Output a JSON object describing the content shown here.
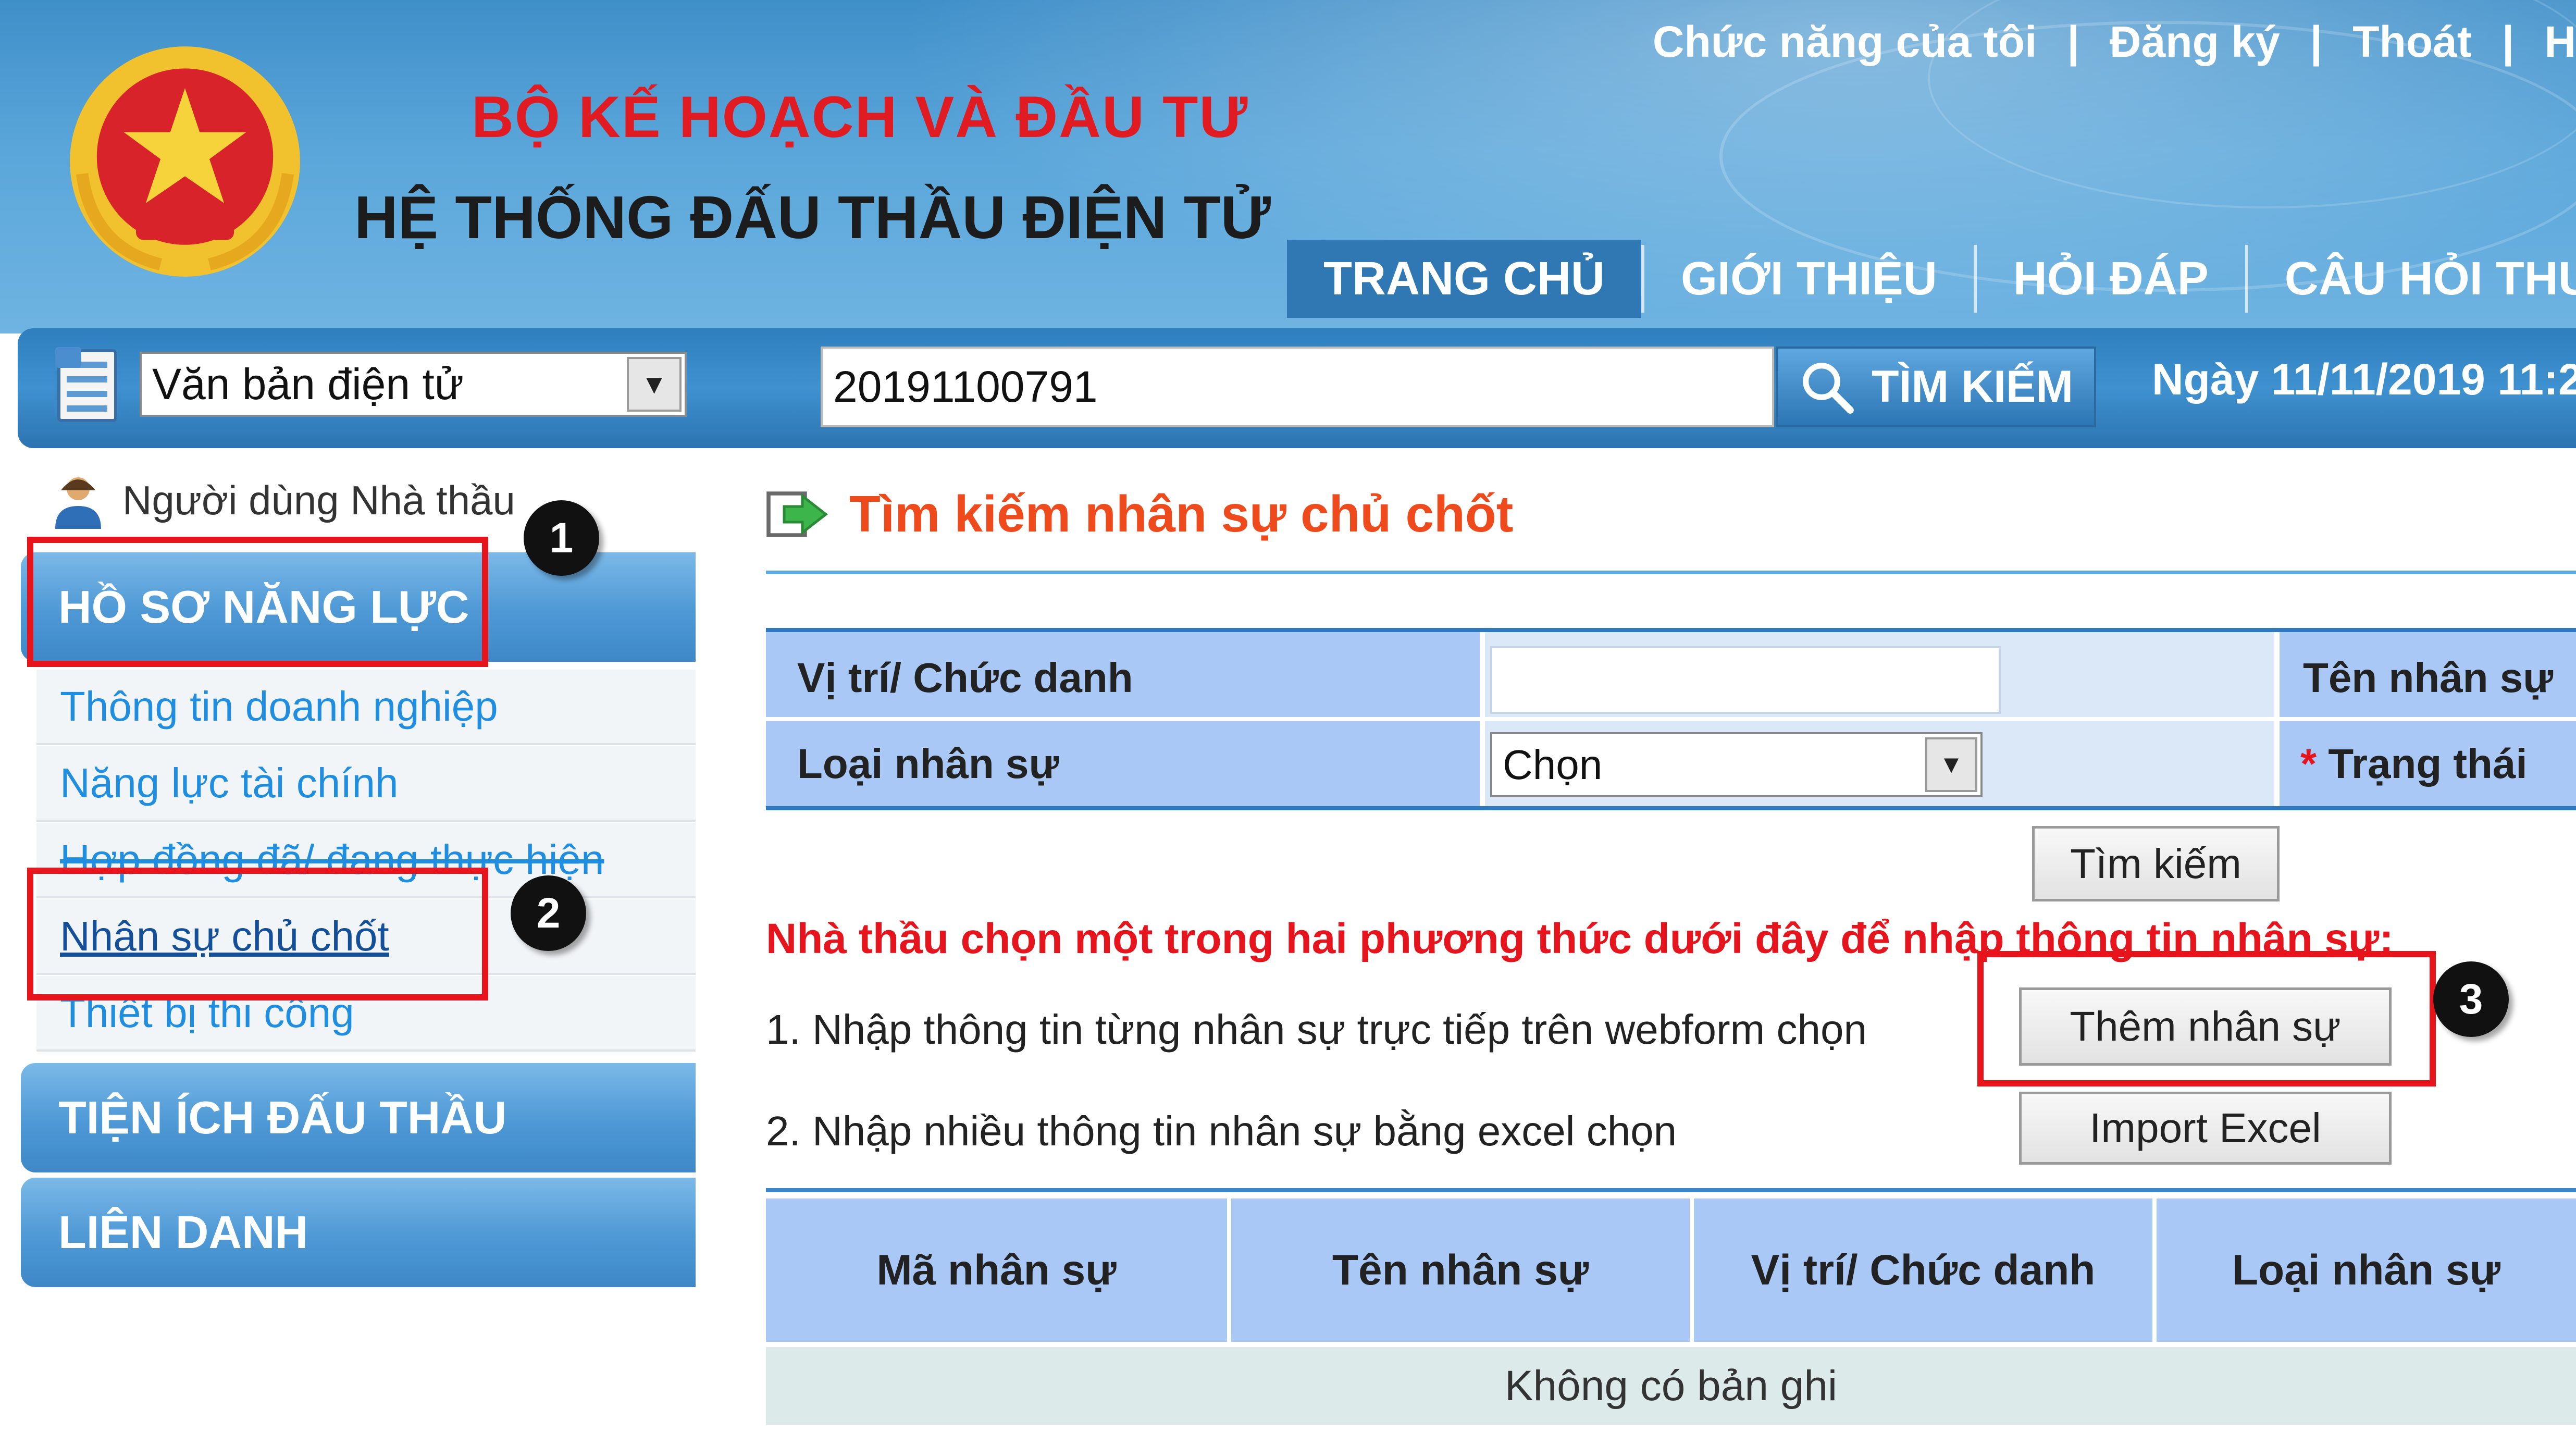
{
  "header": {
    "ministry": "BỘ KẾ HOẠCH VÀ ĐẦU TƯ",
    "system_name": "HỆ THỐNG ĐẤU THẦU ĐIỆN TỬ",
    "top_links": [
      "Chức năng của tôi",
      "Đăng ký",
      "Thoát",
      "H"
    ],
    "nav_tabs": [
      "TRANG CHỦ",
      "GIỚI THIỆU",
      "HỎI ĐÁP",
      "CÂU HỎI THƯỜNG"
    ],
    "active_tab": "TRANG CHỦ",
    "emblem_icon": "national-emblem"
  },
  "search": {
    "doc_type": "Văn bản điện tử",
    "query": "20191100791",
    "button": "TÌM KIẾM",
    "date": "Ngày 11/11/2019 11:2"
  },
  "sidebar": {
    "user": "Người dùng Nhà thầu",
    "sections": [
      {
        "title": "HỒ SƠ NĂNG LỰC",
        "items": [
          "Thông tin doanh nghiệp",
          "Năng lực tài chính",
          "Hợp đồng đã/ đang thực hiện",
          "Nhân sự chủ chốt",
          "Thiết bị thi công"
        ]
      },
      {
        "title": "TIỆN ÍCH ĐẤU THẦU"
      },
      {
        "title": "LIÊN DANH"
      }
    ],
    "selected_item": "Nhân sự chủ chốt"
  },
  "main": {
    "title": "Tìm kiếm nhân sự chủ chốt",
    "filter": {
      "position_label": "Vị trí/ Chức danh",
      "position_value": "",
      "type_label": "Loại nhân sự",
      "type_value": "Chọn",
      "name_label": "Tên nhân sự",
      "status_required": "*",
      "status_label": "Trạng thái",
      "search_button": "Tìm kiếm"
    },
    "notice": "Nhà thầu chọn một trong hai phương thức dưới đây để nhập thông tin nhân sự:",
    "option1": "1. Nhập thông tin từng nhân sự trực tiếp trên webform chọn",
    "option1_button": "Thêm nhân sự",
    "option2": "2. Nhập nhiều thông tin nhân sự bằng excel chọn",
    "option2_button": "Import Excel",
    "table": {
      "columns": [
        "Mã nhân sự",
        "Tên nhân sự",
        "Vị trí/ Chức danh",
        "Loại nhân sự"
      ],
      "empty": "Không có bản ghi"
    }
  },
  "annotations": [
    "1",
    "2",
    "3"
  ],
  "colors": {
    "header_blue": "#4d9bd3",
    "ministry_red": "#e01b22",
    "title_orange": "#ef4a1c",
    "notice_red": "#e6141c",
    "link_blue": "#1f8ee0",
    "highlight_red": "#e8141c"
  }
}
